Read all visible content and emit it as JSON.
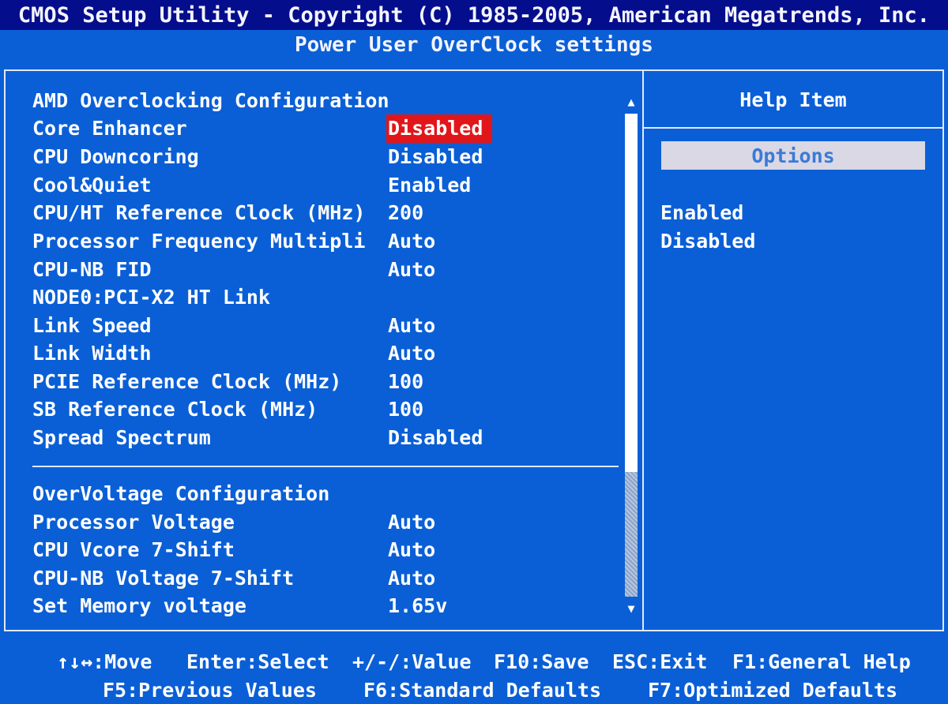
{
  "header": {
    "title": "CMOS Setup Utility - Copyright (C) 1985-2005, American Megatrends, Inc.",
    "subtitle": "Power User OverClock settings"
  },
  "settings": {
    "section1_title": "AMD Overclocking Configuration",
    "rows1": [
      {
        "label": "Core Enhancer",
        "value": "Disabled"
      },
      {
        "label": "CPU Downcoring",
        "value": "Disabled"
      },
      {
        "label": "Cool&Quiet",
        "value": "Enabled"
      },
      {
        "label": "CPU/HT Reference Clock (MHz)",
        "value": "200"
      },
      {
        "label": "Processor Frequency Multipli",
        "value": "Auto"
      },
      {
        "label": "CPU-NB FID",
        "value": "Auto"
      },
      {
        "label": "NODE0:PCI-X2 HT Link",
        "value": ""
      },
      {
        "label": "Link Speed",
        "value": "Auto"
      },
      {
        "label": "Link Width",
        "value": "Auto"
      },
      {
        "label": "PCIE Reference Clock (MHz)",
        "value": "100"
      },
      {
        "label": "SB Reference Clock (MHz)",
        "value": "100"
      },
      {
        "label": "Spread Spectrum",
        "value": "Disabled"
      }
    ],
    "section2_title": "OverVoltage Configuration",
    "rows2": [
      {
        "label": "Processor Voltage",
        "value": "Auto"
      },
      {
        "label": "CPU Vcore 7-Shift",
        "value": "Auto"
      },
      {
        "label": "CPU-NB Voltage 7-Shift",
        "value": "Auto"
      },
      {
        "label": "Set Memory voltage",
        "value": "1.65v"
      }
    ]
  },
  "scrollbar": {
    "up_arrow": "▲",
    "down_arrow": "▼"
  },
  "help": {
    "title": "Help Item",
    "options_label": "Options",
    "options": [
      "Enabled",
      "Disabled"
    ]
  },
  "footer": {
    "line1": [
      "↑↓↔:Move",
      "Enter:Select",
      "+/-/:Value",
      "F10:Save",
      "ESC:Exit",
      "F1:General Help"
    ],
    "line2": [
      "F5:Previous Values",
      "F6:Standard Defaults",
      "F7:Optimized Defaults"
    ]
  },
  "colors": {
    "background": "#0a5fd6",
    "title_bar": "#040e8c",
    "selection": "#e0161a",
    "options_bar": "#dad8e4",
    "options_text": "#3a7ad8"
  }
}
